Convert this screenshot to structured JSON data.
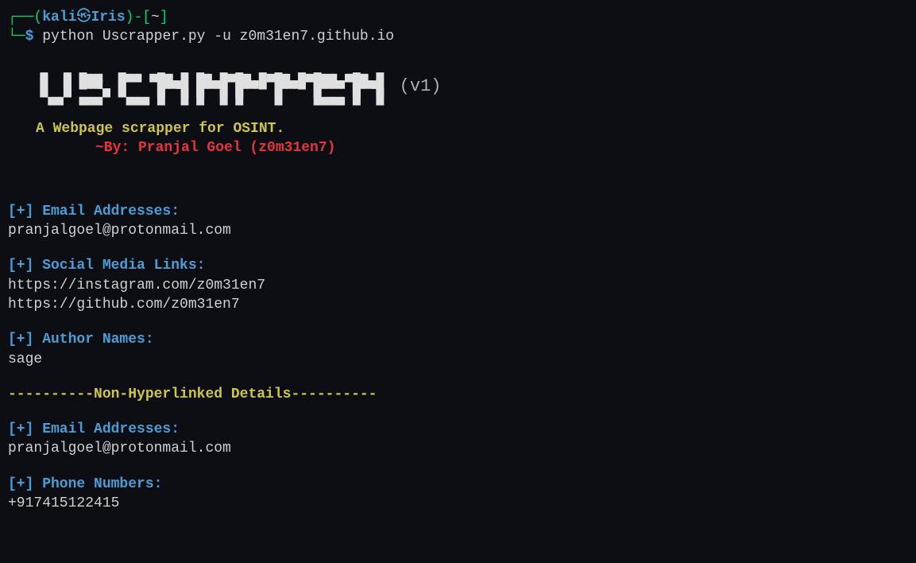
{
  "prompt": {
    "user": "kali",
    "host": "Iris",
    "cwd": "~",
    "symbol": "$",
    "command": "python Uscrapper.py -u z0m31en7.github.io"
  },
  "banner": {
    "name": "USCRAPPER",
    "version": "(v1)",
    "tagline": "A Webpage scrapper for OSINT.",
    "byline": "~By: Pranjal Goel (z0m31en7)"
  },
  "sections": {
    "emails_header": "[+] Email Addresses:",
    "emails_value": "pranjalgoel@protonmail.com",
    "social_header": "[+] Social Media Links:",
    "social_value1": "https://instagram.com/z0m31en7",
    "social_value2": "https://github.com/z0m31en7",
    "authors_header": "[+] Author Names:",
    "authors_value": "sage",
    "divider": "----------Non-Hyperlinked Details----------",
    "emails2_header": "[+] Email Addresses:",
    "emails2_value": "pranjalgoel@protonmail.com",
    "phone_header": "[+] Phone Numbers:",
    "phone_value": "+917415122415"
  }
}
